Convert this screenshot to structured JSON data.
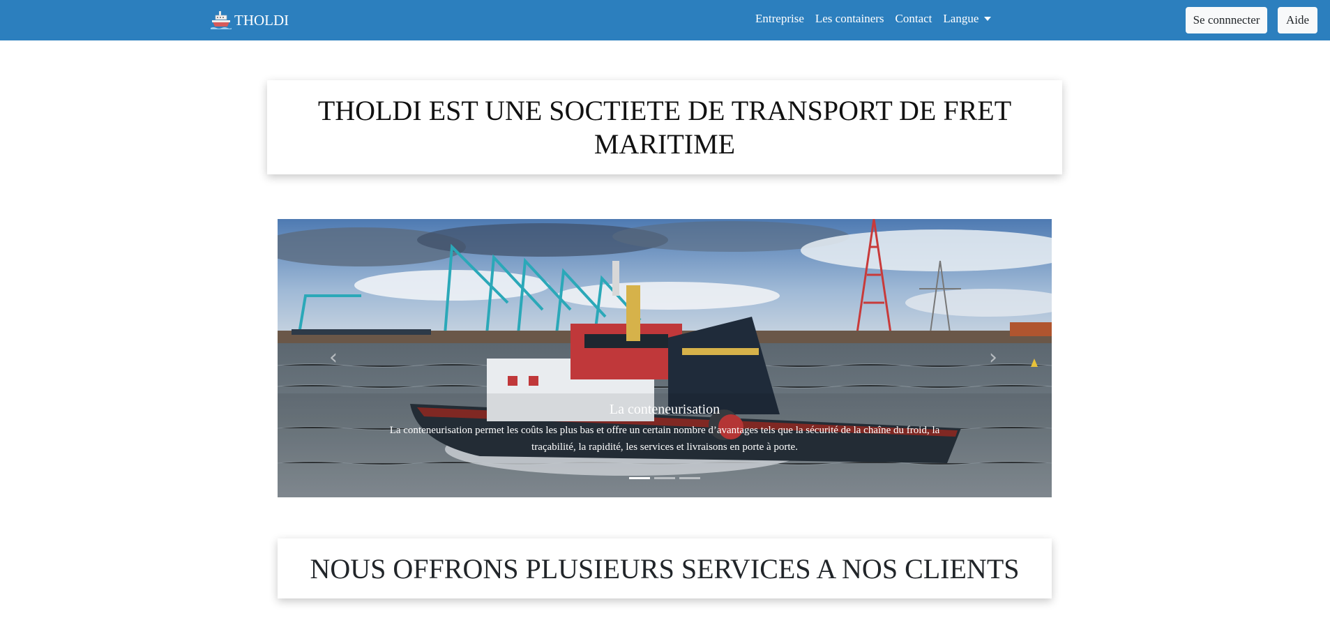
{
  "navbar": {
    "brand": "THOLDI",
    "brand_icon": "ship-icon",
    "links": [
      "Entreprise",
      "Les containers",
      "Contact"
    ],
    "dropdown_label": "Langue",
    "login_button": "Se connnecter",
    "help_button": "Aide",
    "background_color": "#2c7fbe"
  },
  "hero": {
    "title": "THOLDI EST UNE SOCTIETE DE TRANSPORT DE FRET MARITIME"
  },
  "carousel": {
    "slide_image": "tugboat-harbor-photo",
    "caption_title": "La conteneurisation",
    "caption_text": "La conteneurisation permet les coûts les plus bas et offre un certain nombre d’avantages tels que la sécurité de la chaîne du froid, la traçabilité, la rapidité, les services et livraisons en porte à porte.",
    "prev_icon": "chevron-left-icon",
    "next_icon": "chevron-right-icon",
    "slide_count": 3,
    "active_slide": 1
  },
  "services": {
    "title": "NOUS OFFRONS PLUSIEURS SERVICES A NOS CLIENTS"
  }
}
